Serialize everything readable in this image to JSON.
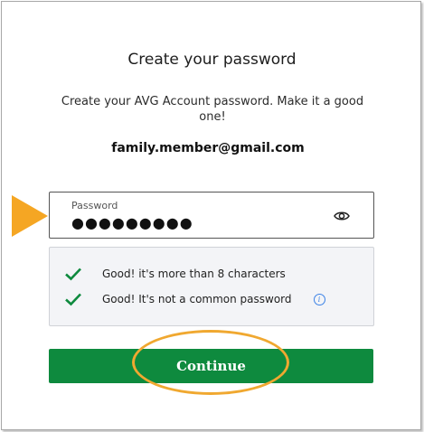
{
  "page": {
    "title": "Create your password",
    "subtitle": "Create your AVG Account password. Make it a good one!",
    "email": "family.member@gmail.com"
  },
  "password_field": {
    "label": "Password",
    "value": "●●●●●●●●●",
    "toggle_icon": "eye-icon"
  },
  "requirements": [
    {
      "icon": "checkmark-icon",
      "text": "Good! it's more than 8 characters"
    },
    {
      "icon": "checkmark-icon",
      "text": "Good! It's not a common password",
      "info_icon": "info-icon"
    }
  ],
  "continue_button": {
    "label": "Continue"
  },
  "colors": {
    "button_green": "#0e8a3e",
    "check_green": "#0e8a3e",
    "annotation_orange": "#f5a623",
    "info_blue": "#3c82e6"
  }
}
